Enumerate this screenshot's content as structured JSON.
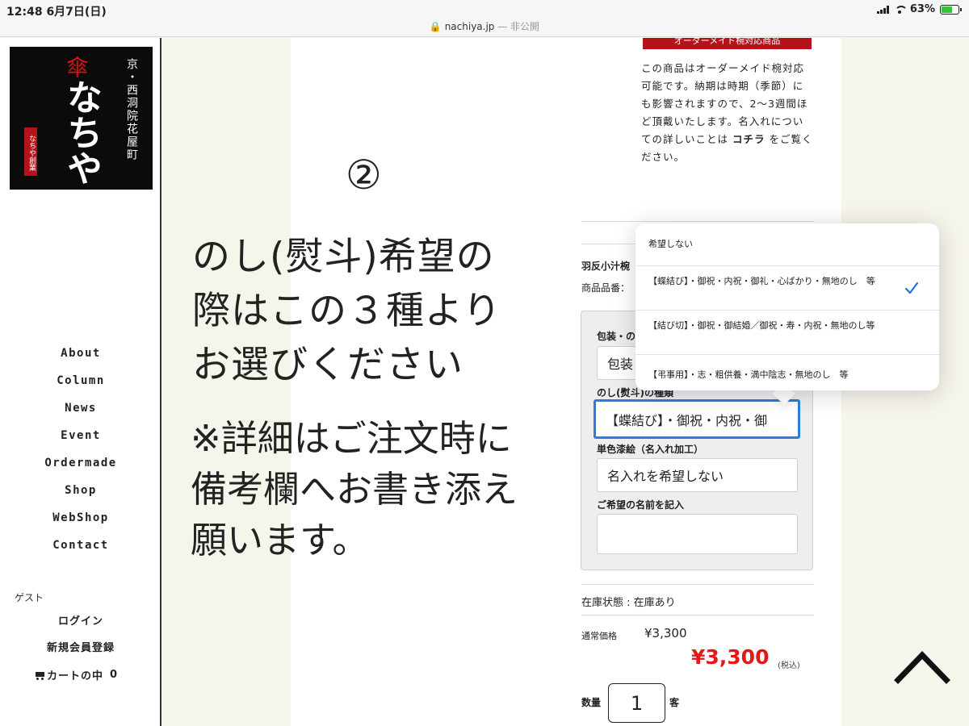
{
  "status": {
    "time": "12:48 6月7日(日)",
    "domain": "nachiya.jp",
    "private": " — 非公開",
    "battery": "63%",
    "battery_level": 0.63
  },
  "logo": {
    "vertical_text": "京・西洞院花屋町",
    "main": "なちや",
    "stamp": "なちや創業",
    "umbrella_glyph": "傘"
  },
  "nav": [
    "About",
    "Column",
    "News",
    "Event",
    "Ordermade",
    "Shop",
    "WebShop",
    "Contact"
  ],
  "account": {
    "guest": "ゲスト",
    "login": "ログイン",
    "register": "新規会員登録",
    "cart_label": "カートの中",
    "cart_count": "0"
  },
  "overlay": {
    "number": "②",
    "main_lines": [
      "のし(熨斗)希望の",
      "際はこの３種より",
      "お選びください"
    ],
    "note_lines": [
      "※詳細はご注文時に",
      "備考欄へお書き添え",
      "願います。"
    ]
  },
  "product": {
    "badge": "オーダーメイド椀対応商品",
    "description": "この商品はオーダーメイド椀対応可能です。納期は時期（季節）にも影響されますので、2〜3週間ほど頂戴いたします。名入れについての詳しいことは",
    "link": "コチラ",
    "description_end": "をご覧ください。",
    "name": "羽反小汁椀",
    "code_label": "商品品番：",
    "stock": "在庫状態 : 在庫あり",
    "regular_label": "通常価格",
    "regular_price": "¥3,300",
    "sale_price": "¥3,300",
    "tax": "(税込)",
    "qty_label": "数量",
    "qty": "1",
    "qty_unit": "客"
  },
  "options": {
    "wrap_label": "包装・の",
    "wrap_value": "包装",
    "noshi_label": "のし(熨斗)の種類",
    "noshi_value": "【蝶結び】・御祝・内祝・御",
    "paint_label": "単色漆絵（名入れ加工）",
    "paint_value": "名入れを希望しない",
    "name_label": "ご希望の名前を記入",
    "name_value": ""
  },
  "dropdown": {
    "items": [
      "希望しない",
      "【蝶結び】・御祝・内祝・御礼・心ばかり・無地のし　等",
      "【結び切】・御祝・御結婚／御祝・寿・内祝・無地のし等",
      "【弔事用】・志・粗供養・満中陰志・無地のし　等"
    ],
    "selected_index": 1
  },
  "colors": {
    "accent_red": "#b3141a",
    "price_red": "#e51717",
    "focus_blue": "#2a7de1",
    "check_blue": "#1f6fe0",
    "battery_green": "#33c23a"
  }
}
